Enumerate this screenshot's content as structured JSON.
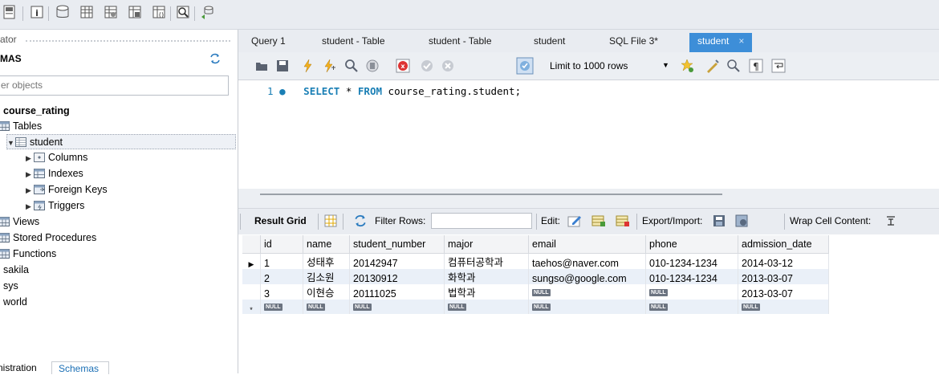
{
  "navigator": {
    "header_label": "ator",
    "schemas_label": "MAS",
    "filter_placeholder": "er objects"
  },
  "tree": {
    "schema": "course_rating",
    "tables_label": "Tables",
    "table": "student",
    "table_children": [
      "Columns",
      "Indexes",
      "Foreign Keys",
      "Triggers"
    ],
    "sections": [
      "Views",
      "Stored Procedures",
      "Functions"
    ],
    "other_schemas": [
      "sakila",
      "sys",
      "world"
    ]
  },
  "bottom_tabs": {
    "admin": "nistration",
    "schemas": "Schemas"
  },
  "editor_tabs": [
    "Query 1",
    "student - Table",
    "student - Table",
    "student",
    "SQL File 3*",
    "student"
  ],
  "editor_tab_close": "×",
  "sql_toolbar": {
    "limit_label": "Limit to 1000 rows",
    "limit_arrow": "▼"
  },
  "editor": {
    "line_no": "1",
    "line_dot": "●",
    "kw1": "SELECT",
    "star": " * ",
    "kw2": "FROM",
    "rest": " course_rating.student;"
  },
  "result_toolbar": {
    "result_grid": "Result Grid",
    "filter_rows": "Filter Rows:",
    "edit": "Edit:",
    "export_import": "Export/Import:",
    "wrap": "Wrap Cell Content:"
  },
  "grid": {
    "columns": [
      "id",
      "name",
      "student_number",
      "major",
      "email",
      "phone",
      "admission_date"
    ],
    "rows": [
      [
        "1",
        "성태후",
        "20142947",
        "컴퓨터공학과",
        "taehos@naver.com",
        "010-1234-1234",
        "2014-03-12"
      ],
      [
        "2",
        "김소원",
        "20130912",
        "화학과",
        "sungso@google.com",
        "010-1234-1234",
        "2013-03-07"
      ],
      [
        "3",
        "이현승",
        "20111025",
        "법학과",
        "NULL",
        "NULL",
        "2013-03-07"
      ],
      [
        "NULL",
        "NULL",
        "NULL",
        "NULL",
        "NULL",
        "NULL",
        "NULL"
      ]
    ],
    "row_indicators": [
      "▶",
      "",
      "",
      "*"
    ],
    "null_text": "NULL"
  },
  "colors": {
    "active_tab": "#3d8ed8",
    "keyword": "#1a7fb5",
    "null_badge": "#6b7380"
  }
}
